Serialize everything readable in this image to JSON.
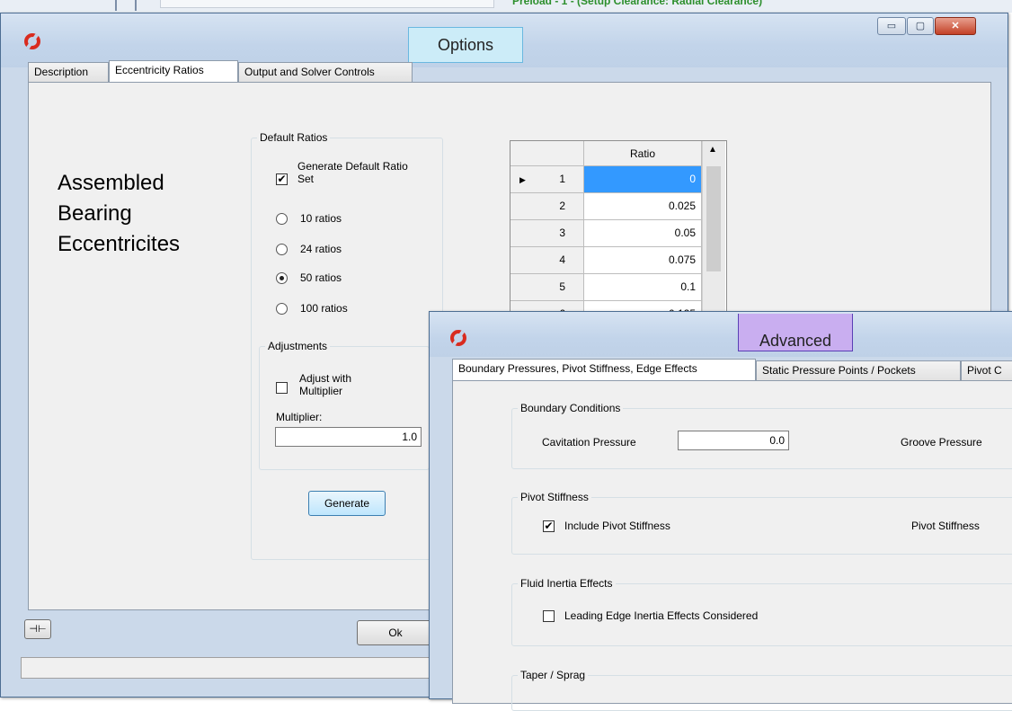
{
  "background": {
    "text": "Preload - 1 - (Setup Clearance: Radial Clearance)"
  },
  "options_window": {
    "title": "Options",
    "controls": {
      "minimize": "▭",
      "maximize": "▢",
      "close": "✕"
    },
    "tabs": [
      {
        "label": "Description"
      },
      {
        "label": "Eccentricity Ratios"
      },
      {
        "label": "Output and Solver Controls"
      }
    ],
    "heading_lines": [
      "Assembled",
      "Bearing",
      "Eccentricites"
    ],
    "default_ratios": {
      "legend": "Default Ratios",
      "generate_default_label": "Generate Default Ratio Set",
      "generate_default_checked": true,
      "radios": [
        {
          "label": "10 ratios",
          "selected": false
        },
        {
          "label": "24 ratios",
          "selected": false
        },
        {
          "label": "50 ratios",
          "selected": true
        },
        {
          "label": "100 ratios",
          "selected": false
        }
      ]
    },
    "adjustments": {
      "legend": "Adjustments",
      "adjust_label": "Adjust with Multiplier",
      "adjust_checked": false,
      "multiplier_label": "Multiplier:",
      "multiplier_value": "1.0"
    },
    "generate_button": "Generate",
    "ok_button": "Ok",
    "pin_icon": "pin-icon",
    "grid": {
      "header": "Ratio",
      "rows": [
        {
          "num": "1",
          "value": "0",
          "current": true
        },
        {
          "num": "2",
          "value": "0.025"
        },
        {
          "num": "3",
          "value": "0.05"
        },
        {
          "num": "4",
          "value": "0.075"
        },
        {
          "num": "5",
          "value": "0.1"
        },
        {
          "num": "6",
          "value": "0.125"
        }
      ]
    }
  },
  "advanced_window": {
    "title": "Advanced",
    "tabs": [
      {
        "label": "Boundary Pressures, Pivot Stiffness, Edge Effects"
      },
      {
        "label": "Static Pressure Points / Pockets"
      },
      {
        "label": "Pivot C"
      }
    ],
    "boundary": {
      "legend": "Boundary Conditions",
      "cavitation_label": "Cavitation Pressure",
      "cavitation_value": "0.0",
      "groove_label": "Groove Pressure"
    },
    "pivot": {
      "legend": "Pivot Stiffness",
      "include_label": "Include Pivot Stiffness",
      "include_checked": true,
      "stiffness_label": "Pivot Stiffness"
    },
    "fluid": {
      "legend": "Fluid Inertia Effects",
      "leading_label": "Leading Edge Inertia Effects Considered",
      "leading_checked": false
    },
    "taper": {
      "legend": "Taper / Sprag"
    }
  },
  "colors": {
    "title_box_options": "#ccecf8",
    "title_box_advanced": "#c9aef0",
    "logo": "#d92b1f",
    "selected_cell": "#3399ff"
  }
}
